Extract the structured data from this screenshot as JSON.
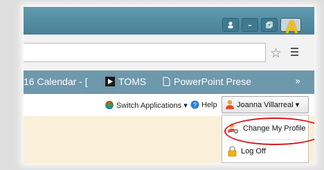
{
  "window": {
    "minimize_label": "–",
    "restore_label": "▫",
    "annotation_letter": "A"
  },
  "toolbar": {
    "star_icon": "star-icon",
    "menu_icon": "menu-icon"
  },
  "bookmarks": [
    {
      "label": "16 Calendar - ["
    },
    {
      "label": "TOMS"
    },
    {
      "label": "PowerPoint Prese"
    }
  ],
  "bookmarks_overflow": "»",
  "appbar": {
    "switch_label": "Switch Applications ▾",
    "help_label": "Help",
    "user_label": "Joanna Villarreal ▾"
  },
  "user_menu": {
    "items": [
      {
        "label": "Change My Profile",
        "icon": "profile-icon"
      },
      {
        "label": "Log Off",
        "icon": "lock-icon"
      }
    ]
  },
  "colors": {
    "highlight_ring": "#d7191c",
    "title_bar": "#5f9bb0",
    "bookmark_bar": "#6e98ab"
  }
}
